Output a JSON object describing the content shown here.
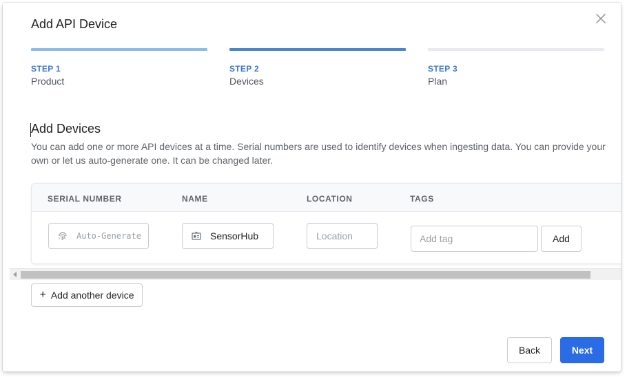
{
  "dialog": {
    "title": "Add API Device",
    "close_icon": "close-icon"
  },
  "steps": [
    {
      "number": "STEP 1",
      "label": "Product",
      "state": "complete",
      "bar_color": "#8bbcec",
      "text_color": "#3a78c9"
    },
    {
      "number": "STEP 2",
      "label": "Devices",
      "state": "current",
      "bar_color": "#4a86cf",
      "text_color": "#3a78c9"
    },
    {
      "number": "STEP 3",
      "label": "Plan",
      "state": "upcoming",
      "bar_color": "#e8eaed",
      "text_color": "#3a78c9"
    }
  ],
  "section": {
    "title": "Add Devices",
    "description": "You can add one or more API devices at a time. Serial numbers are used to identify devices when ingesting data. You can provide your own or let us auto-generate one. It can be changed later."
  },
  "table": {
    "columns": [
      "SERIAL NUMBER",
      "NAME",
      "LOCATION",
      "TAGS"
    ],
    "row": {
      "serial_button_label": "Auto-Generate",
      "serial_icon": "fingerprint-icon",
      "name_value": "SensorHub",
      "name_icon": "id-badge-icon",
      "location_placeholder": "Location",
      "tag_placeholder": "Add tag",
      "tag_add_label": "Add"
    }
  },
  "actions": {
    "add_another_label": "Add another device",
    "add_icon": "plus-icon",
    "back_label": "Back",
    "next_label": "Next",
    "primary_color": "#2b6be6"
  }
}
